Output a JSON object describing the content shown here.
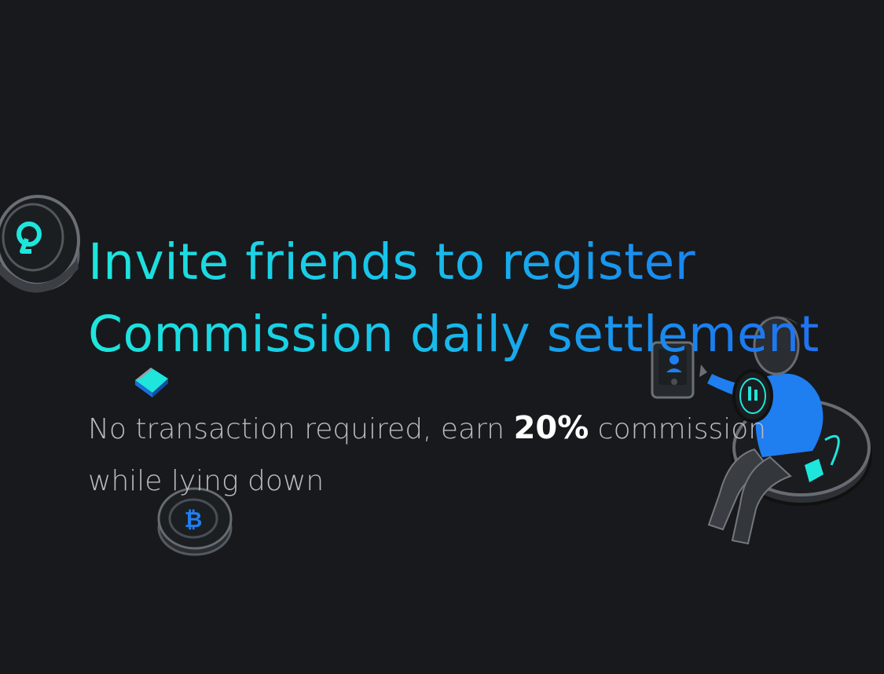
{
  "hero": {
    "title_line1": "Invite friends to register",
    "title_line2": "Commission daily settlement",
    "subtitle_before": "No transaction required, earn ",
    "subtitle_highlight": "20%",
    "subtitle_after": " commission",
    "subtitle_line2": "while lying down"
  },
  "colors": {
    "background": "#17191c",
    "title_gradient_start": "#1ee6dc",
    "title_gradient_end": "#2170f2",
    "subtitle": "#b9bcc2",
    "highlight": "#ffffff",
    "accent_blue": "#1f7ef0",
    "accent_cyan": "#1ee6dc"
  },
  "icons": [
    "coin-icon",
    "bitcoin-coin-icon",
    "cube-icon",
    "person-illustration"
  ]
}
